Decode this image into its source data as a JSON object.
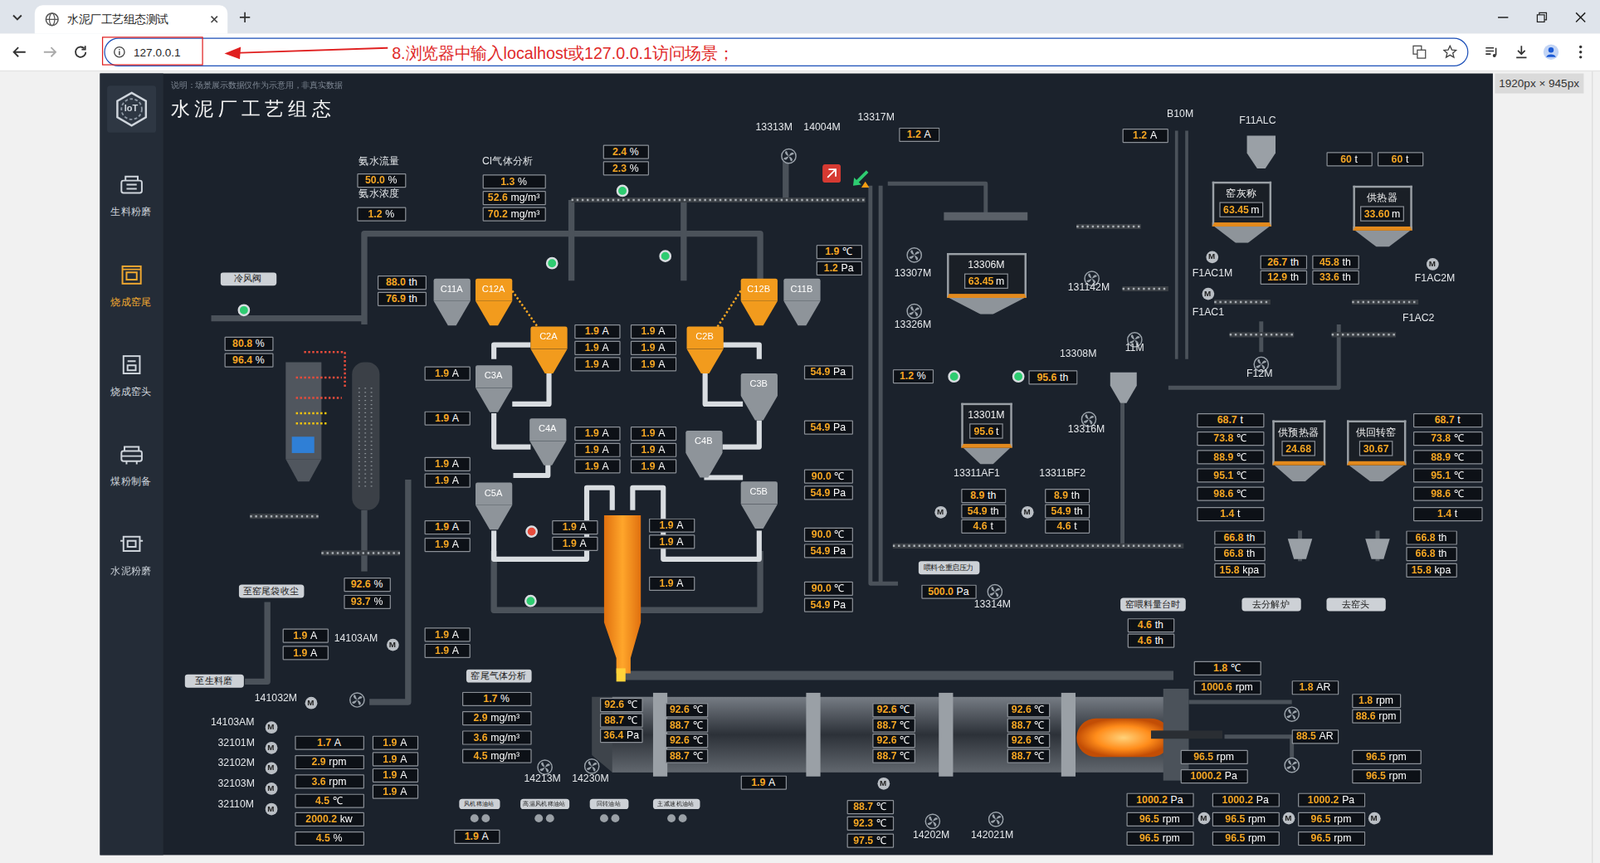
{
  "browser": {
    "tab_title": "水泥厂工艺组态测试",
    "url": "127.0.0.1"
  },
  "annotation": "8.浏览器中输入localhost或127.0.0.1访问场景；",
  "viewport_label": "1920px × 945px",
  "scene": {
    "title": "水泥厂工艺组态",
    "note": "说明：场景展示数据仅作为示意用，非真实数据",
    "logo": "IoT"
  },
  "sidebar": {
    "items": [
      {
        "label": "生料粉磨",
        "selected": false
      },
      {
        "label": "烧成窑尾",
        "selected": true
      },
      {
        "label": "烧成窑头",
        "selected": false
      },
      {
        "label": "煤粉制备",
        "selected": false
      },
      {
        "label": "水泥粉磨",
        "selected": false
      }
    ]
  },
  "motor_symbol": "M",
  "labels": [
    "氨水流量",
    "氨水浓度",
    "CI气体分析",
    "13313M",
    "14004M",
    "13317M",
    "B10M",
    "F11ALC",
    "13307M",
    "13326M",
    "131142M",
    "F1AC1M",
    "F1AC2M",
    "F1AC1",
    "F1AC2",
    "11M",
    "13308M",
    "F12M",
    "13316M",
    "13311AF1",
    "13311BF2",
    "13314M",
    "14103AM",
    "141032M",
    "14103AM",
    "32101M",
    "32102M",
    "32103M",
    "32110M",
    "14213M",
    "14230M",
    "14202M",
    "142021M"
  ],
  "buttons": [
    "冷风阀",
    "至窑尾袋收尘",
    "至生料磨",
    "窑尾气体分析",
    "喂料仓重启压力",
    "窑喂料量台时",
    "去分解炉",
    "去窑头",
    "风机稀油站",
    "高温风机稀油站",
    "回转油站",
    "主减速机油站"
  ],
  "cyclones": [
    {
      "name": "C11A",
      "color": "#8e949a"
    },
    {
      "name": "C12A",
      "color": "#f29b1d"
    },
    {
      "name": "C2A",
      "color": "#f29b1d"
    },
    {
      "name": "C3A",
      "color": "#8e949a"
    },
    {
      "name": "C4A",
      "color": "#8e949a"
    },
    {
      "name": "C5A",
      "color": "#8e949a"
    },
    {
      "name": "C12B",
      "color": "#f29b1d"
    },
    {
      "name": "C11B",
      "color": "#8e949a"
    },
    {
      "name": "C2B",
      "color": "#f29b1d"
    },
    {
      "name": "C3B",
      "color": "#8e949a"
    },
    {
      "name": "C4B",
      "color": "#8e949a"
    },
    {
      "name": "C5B",
      "color": "#8e949a"
    }
  ],
  "vessels": [
    {
      "name": "窑灰称",
      "value": "63.45",
      "unit": "m"
    },
    {
      "name": "供热器",
      "value": "33.60",
      "unit": "m"
    },
    {
      "name": "13306M",
      "value": "63.45",
      "unit": "m"
    },
    {
      "name": "13301M",
      "value": "95.6",
      "unit": "t"
    },
    {
      "name": "供预热器",
      "value": "24.68"
    },
    {
      "name": "供回转窑",
      "value": "30.67"
    }
  ],
  "valves": [
    {
      "open": true
    },
    {
      "open": true
    },
    {
      "open": true
    },
    {
      "open": true
    },
    {
      "open": true
    },
    {
      "open": true
    },
    {
      "open": true
    },
    {
      "open": false
    }
  ],
  "readouts": [
    {
      "value": "2.4",
      "unit": "%"
    },
    {
      "value": "2.3",
      "unit": "%"
    },
    {
      "value": "50.0",
      "unit": "%"
    },
    {
      "value": "1.2",
      "unit": "%"
    },
    {
      "value": "1.3",
      "unit": "%"
    },
    {
      "value": "52.6",
      "unit": "mg/m³"
    },
    {
      "value": "70.2",
      "unit": "mg/m³"
    },
    {
      "value": "1.2",
      "unit": "A"
    },
    {
      "value": "1.2",
      "unit": "A"
    },
    {
      "value": "60",
      "unit": "t"
    },
    {
      "value": "60",
      "unit": "t"
    },
    {
      "value": "26.7",
      "unit": "th"
    },
    {
      "value": "12.9",
      "unit": "th"
    },
    {
      "value": "45.8",
      "unit": "th"
    },
    {
      "value": "33.6",
      "unit": "th"
    },
    {
      "value": "1.2",
      "unit": "%"
    },
    {
      "value": "95.6",
      "unit": "th"
    },
    {
      "value": "8.9",
      "unit": "th"
    },
    {
      "value": "54.9",
      "unit": "th"
    },
    {
      "value": "4.6",
      "unit": "t"
    },
    {
      "value": "8.9",
      "unit": "th"
    },
    {
      "value": "54.9",
      "unit": "th"
    },
    {
      "value": "4.6",
      "unit": "t"
    },
    {
      "value": "500.0",
      "unit": "Pa"
    },
    {
      "value": "4.6",
      "unit": "th"
    },
    {
      "value": "4.6",
      "unit": "th"
    },
    {
      "value": "68.7",
      "unit": "t"
    },
    {
      "value": "73.8",
      "unit": "℃"
    },
    {
      "value": "88.9",
      "unit": "℃"
    },
    {
      "value": "95.1",
      "unit": "℃"
    },
    {
      "value": "98.6",
      "unit": "℃"
    },
    {
      "value": "1.4",
      "unit": "t"
    },
    {
      "value": "68.7",
      "unit": "t"
    },
    {
      "value": "73.8",
      "unit": "℃"
    },
    {
      "value": "88.9",
      "unit": "℃"
    },
    {
      "value": "95.1",
      "unit": "℃"
    },
    {
      "value": "98.6",
      "unit": "℃"
    },
    {
      "value": "1.4",
      "unit": "t"
    },
    {
      "value": "66.8",
      "unit": "th"
    },
    {
      "value": "66.8",
      "unit": "th"
    },
    {
      "value": "15.8",
      "unit": "kpa"
    },
    {
      "value": "66.8",
      "unit": "th"
    },
    {
      "value": "66.8",
      "unit": "th"
    },
    {
      "value": "15.8",
      "unit": "kpa"
    },
    {
      "value": "88.0",
      "unit": "th"
    },
    {
      "value": "76.9",
      "unit": "th"
    },
    {
      "value": "80.8",
      "unit": "%"
    },
    {
      "value": "96.4",
      "unit": "%"
    },
    {
      "value": "1.9",
      "unit": "A"
    },
    {
      "value": "1.9",
      "unit": "A"
    },
    {
      "value": "1.9",
      "unit": "A"
    },
    {
      "value": "1.9",
      "unit": "A"
    },
    {
      "value": "1.9",
      "unit": "A"
    },
    {
      "value": "1.9",
      "unit": "A"
    },
    {
      "value": "1.9",
      "unit": "A"
    },
    {
      "value": "1.9",
      "unit": "A"
    },
    {
      "value": "1.9",
      "unit": "A"
    },
    {
      "value": "1.9",
      "unit": "A"
    },
    {
      "value": "1.9",
      "unit": "A"
    },
    {
      "value": "1.9",
      "unit": "A"
    },
    {
      "value": "1.9",
      "unit": "A"
    },
    {
      "value": "1.9",
      "unit": "A"
    },
    {
      "value": "1.9",
      "unit": "A"
    },
    {
      "value": "1.9",
      "unit": "A"
    },
    {
      "value": "1.9",
      "unit": "A"
    },
    {
      "value": "1.9",
      "unit": "A"
    },
    {
      "value": "1.9",
      "unit": "A"
    },
    {
      "value": "1.9",
      "unit": "A"
    },
    {
      "value": "1.9",
      "unit": "A"
    },
    {
      "value": "1.9",
      "unit": "A"
    },
    {
      "value": "1.9",
      "unit": "A"
    },
    {
      "value": "1.9",
      "unit": "℃"
    },
    {
      "value": "1.2",
      "unit": "Pa"
    },
    {
      "value": "54.9",
      "unit": "Pa"
    },
    {
      "value": "54.9",
      "unit": "Pa"
    },
    {
      "value": "90.0",
      "unit": "℃"
    },
    {
      "value": "54.9",
      "unit": "Pa"
    },
    {
      "value": "90.0",
      "unit": "℃"
    },
    {
      "value": "54.9",
      "unit": "Pa"
    },
    {
      "value": "90.0",
      "unit": "℃"
    },
    {
      "value": "54.9",
      "unit": "Pa"
    },
    {
      "value": "92.6",
      "unit": "%"
    },
    {
      "value": "93.7",
      "unit": "%"
    },
    {
      "value": "1.9",
      "unit": "A"
    },
    {
      "value": "1.9",
      "unit": "A"
    },
    {
      "value": "1.9",
      "unit": "A"
    },
    {
      "value": "1.9",
      "unit": "A"
    },
    {
      "value": "1.7",
      "unit": "A"
    },
    {
      "value": "2.9",
      "unit": "rpm"
    },
    {
      "value": "3.6",
      "unit": "rpm"
    },
    {
      "value": "4.5",
      "unit": "℃"
    },
    {
      "value": "2000.2",
      "unit": "kw"
    },
    {
      "value": "4.5",
      "unit": "%"
    },
    {
      "value": "1.9",
      "unit": "A"
    },
    {
      "value": "1.9",
      "unit": "A"
    },
    {
      "value": "1.9",
      "unit": "A"
    },
    {
      "value": "1.9",
      "unit": "A"
    },
    {
      "value": "1.7",
      "unit": "%"
    },
    {
      "value": "2.9",
      "unit": "mg/m³"
    },
    {
      "value": "3.6",
      "unit": "mg/m³"
    },
    {
      "value": "4.5",
      "unit": "mg/m³"
    },
    {
      "value": "92.6",
      "unit": "℃"
    },
    {
      "value": "88.7",
      "unit": "℃"
    },
    {
      "value": "36.4",
      "unit": "Pa"
    },
    {
      "value": "92.6",
      "unit": "℃"
    },
    {
      "value": "88.7",
      "unit": "℃"
    },
    {
      "value": "92.6",
      "unit": "℃"
    },
    {
      "value": "88.7",
      "unit": "℃"
    },
    {
      "value": "92.6",
      "unit": "℃"
    },
    {
      "value": "88.7",
      "unit": "℃"
    },
    {
      "value": "92.6",
      "unit": "℃"
    },
    {
      "value": "88.7",
      "unit": "℃"
    },
    {
      "value": "92.6",
      "unit": "℃"
    },
    {
      "value": "88.7",
      "unit": "℃"
    },
    {
      "value": "92.6",
      "unit": "℃"
    },
    {
      "value": "88.7",
      "unit": "℃"
    },
    {
      "value": "1.8",
      "unit": "℃"
    },
    {
      "value": "1000.6",
      "unit": "rpm"
    },
    {
      "value": "1.8",
      "unit": "AR"
    },
    {
      "value": "1.8",
      "unit": "rpm"
    },
    {
      "value": "88.6",
      "unit": "rpm"
    },
    {
      "value": "88.5",
      "unit": "AR"
    },
    {
      "value": "96.5",
      "unit": "rpm"
    },
    {
      "value": "1000.2",
      "unit": "Pa"
    },
    {
      "value": "96.5",
      "unit": "rpm"
    },
    {
      "value": "96.5",
      "unit": "rpm"
    },
    {
      "value": "1000.2",
      "unit": "Pa"
    },
    {
      "value": "96.5",
      "unit": "rpm"
    },
    {
      "value": "96.5",
      "unit": "rpm"
    },
    {
      "value": "1000.2",
      "unit": "Pa"
    },
    {
      "value": "96.5",
      "unit": "rpm"
    },
    {
      "value": "96.5",
      "unit": "rpm"
    },
    {
      "value": "1000.2",
      "unit": "Pa"
    },
    {
      "value": "96.5",
      "unit": "rpm"
    },
    {
      "value": "96.5",
      "unit": "rpm"
    },
    {
      "value": "1.9",
      "unit": "A"
    },
    {
      "value": "88.7",
      "unit": "℃"
    },
    {
      "value": "92.3",
      "unit": "℃"
    },
    {
      "value": "97.5",
      "unit": "℃"
    },
    {
      "value": "1.9",
      "unit": "A"
    }
  ]
}
